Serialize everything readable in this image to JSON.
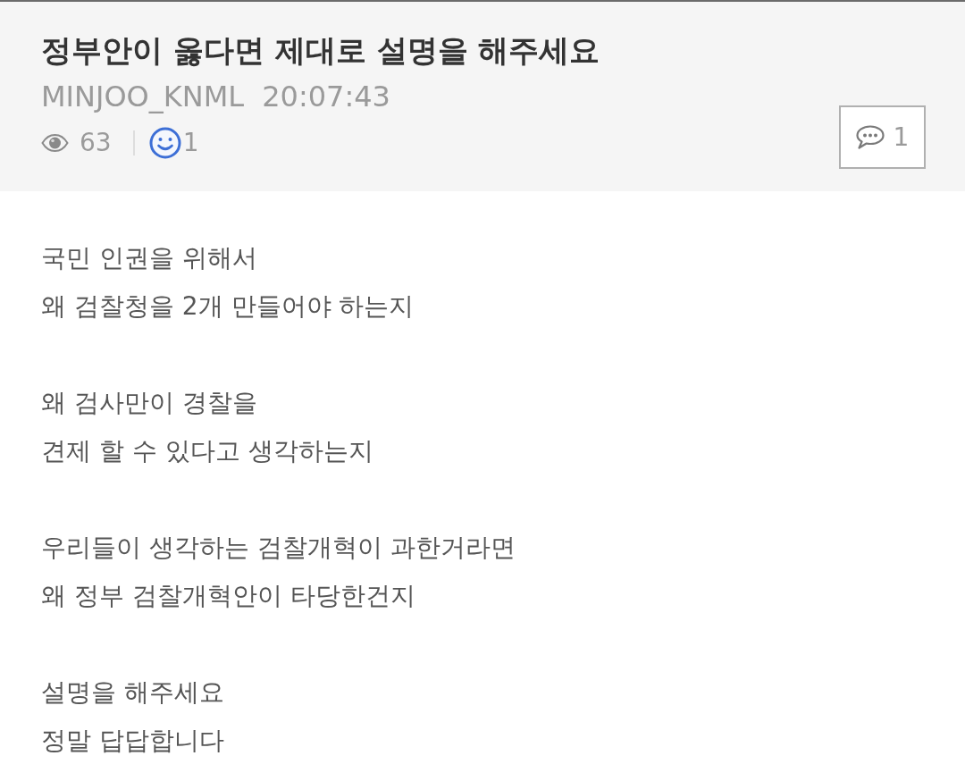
{
  "post": {
    "title": "정부안이 옳다면 제대로 설명을 해주세요",
    "author": "MINJOO_KNML",
    "time": "20:07:43",
    "views": "63",
    "reactions": "1",
    "comments": "1"
  },
  "body": {
    "paragraphs": [
      [
        "국민 인권을 위해서",
        "왜 검찰청을 2개 만들어야 하는지"
      ],
      [
        "왜 검사만이 경찰을",
        "견제 할 수 있다고 생각하는지"
      ],
      [
        "우리들이 생각하는 검찰개혁이 과한거라면",
        "왜 정부 검찰개혁안이 타당한건지"
      ],
      [
        "설명을 해주세요",
        "정말 답답합니다"
      ]
    ]
  }
}
